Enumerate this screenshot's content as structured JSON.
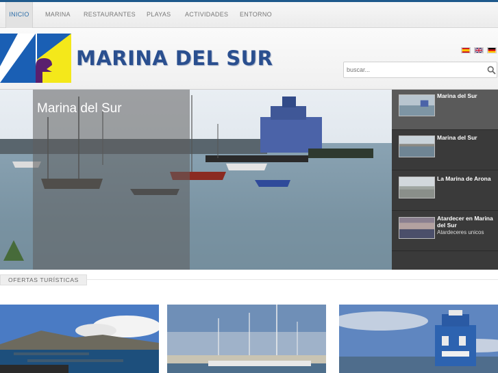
{
  "nav": {
    "items": [
      {
        "label": "INICIO",
        "active": true
      },
      {
        "label": "MARINA"
      },
      {
        "label": "RESTAURANTES"
      },
      {
        "label": "PLAYAS"
      },
      {
        "label": "ACTIVIDADES"
      },
      {
        "label": "ENTORNO"
      }
    ]
  },
  "header": {
    "logo_text": "MARINA DEL SUR",
    "languages": [
      "es-flag",
      "uk-flag",
      "de-flag"
    ],
    "search_placeholder": "buscar..."
  },
  "slider": {
    "caption_title": "Marina del Sur",
    "thumbs": [
      {
        "title": "Marina del Sur",
        "subtitle": "",
        "active": true
      },
      {
        "title": "Marina del Sur",
        "subtitle": ""
      },
      {
        "title": "La Marina de Arona",
        "subtitle": ""
      },
      {
        "title": "Atardecer en Marina del Sur",
        "subtitle": "Atardeceres unicos"
      }
    ]
  },
  "section": {
    "title": "OFERTAS TURÍSTICAS"
  },
  "colors": {
    "brand_blue": "#2a4f8f",
    "nav_active": "#2a6ca8",
    "logo_yellow": "#f4e81a",
    "logo_blue": "#1a5fb4"
  }
}
